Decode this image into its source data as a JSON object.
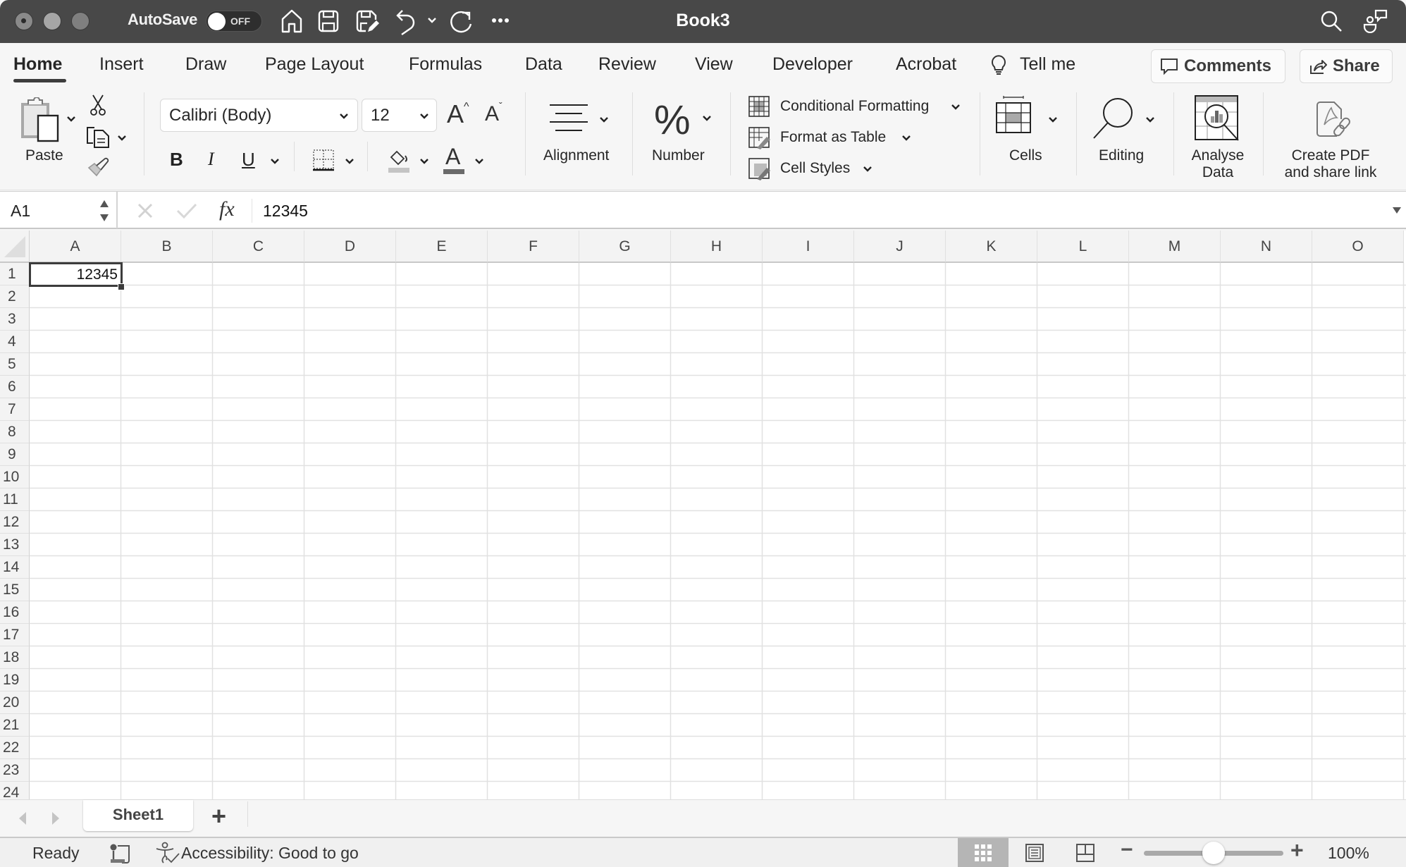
{
  "window": {
    "title": "Book3",
    "autosave_label": "AutoSave",
    "autosave_state": "OFF",
    "titlebar_icons": [
      "home-icon",
      "save-icon",
      "save-as-icon",
      "undo-icon",
      "undo-dropdown-icon",
      "redo-icon",
      "more-icon",
      "search-icon",
      "collaborate-icon"
    ]
  },
  "ribbon_tabs": [
    {
      "label": "Home",
      "active": true
    },
    {
      "label": "Insert"
    },
    {
      "label": "Draw"
    },
    {
      "label": "Page Layout"
    },
    {
      "label": "Formulas"
    },
    {
      "label": "Data"
    },
    {
      "label": "Review"
    },
    {
      "label": "View"
    },
    {
      "label": "Developer"
    },
    {
      "label": "Acrobat"
    },
    {
      "label": "Tell me"
    }
  ],
  "header_buttons": {
    "comments": "Comments",
    "share": "Share"
  },
  "ribbon": {
    "paste_label": "Paste",
    "font_name": "Calibri (Body)",
    "font_size": "12",
    "bold": "B",
    "italic": "I",
    "underline": "U",
    "alignment_label": "Alignment",
    "number_label": "Number",
    "conditional_formatting": "Conditional Formatting",
    "format_as_table": "Format as Table",
    "cell_styles": "Cell Styles",
    "cells_label": "Cells",
    "editing_label": "Editing",
    "analyse_data_label_1": "Analyse",
    "analyse_data_label_2": "Data",
    "create_pdf_label_1": "Create PDF",
    "create_pdf_label_2": "and share link",
    "percent_glyph": "%",
    "increase_font_glyph": "A",
    "decrease_font_glyph": "A",
    "font_color_glyph": "A",
    "colors": {
      "fill_color": "#c4c4c4",
      "font_color": "#6a6a6a"
    }
  },
  "formula_bar": {
    "name_box": "A1",
    "fx_label": "fx",
    "formula": "12345"
  },
  "grid": {
    "columns": [
      "A",
      "B",
      "C",
      "D",
      "E",
      "F",
      "G",
      "H",
      "I",
      "J",
      "K",
      "L",
      "M",
      "N",
      "O"
    ],
    "rows": [
      "1",
      "2",
      "3",
      "4",
      "5",
      "6",
      "7",
      "8",
      "9",
      "10",
      "11",
      "12",
      "13",
      "14",
      "15",
      "16",
      "17",
      "18",
      "19",
      "20",
      "21",
      "22",
      "23",
      "24"
    ],
    "cells": {
      "A1": "12345"
    },
    "selected_cell": "A1"
  },
  "sheets": {
    "tabs": [
      "Sheet1"
    ],
    "active": "Sheet1",
    "add_label": "+"
  },
  "status": {
    "ready": "Ready",
    "accessibility": "Accessibility: Good to go",
    "zoom_minus": "−",
    "zoom_plus": "+",
    "zoom_level": "100%",
    "zoom_fraction": 0.5
  }
}
